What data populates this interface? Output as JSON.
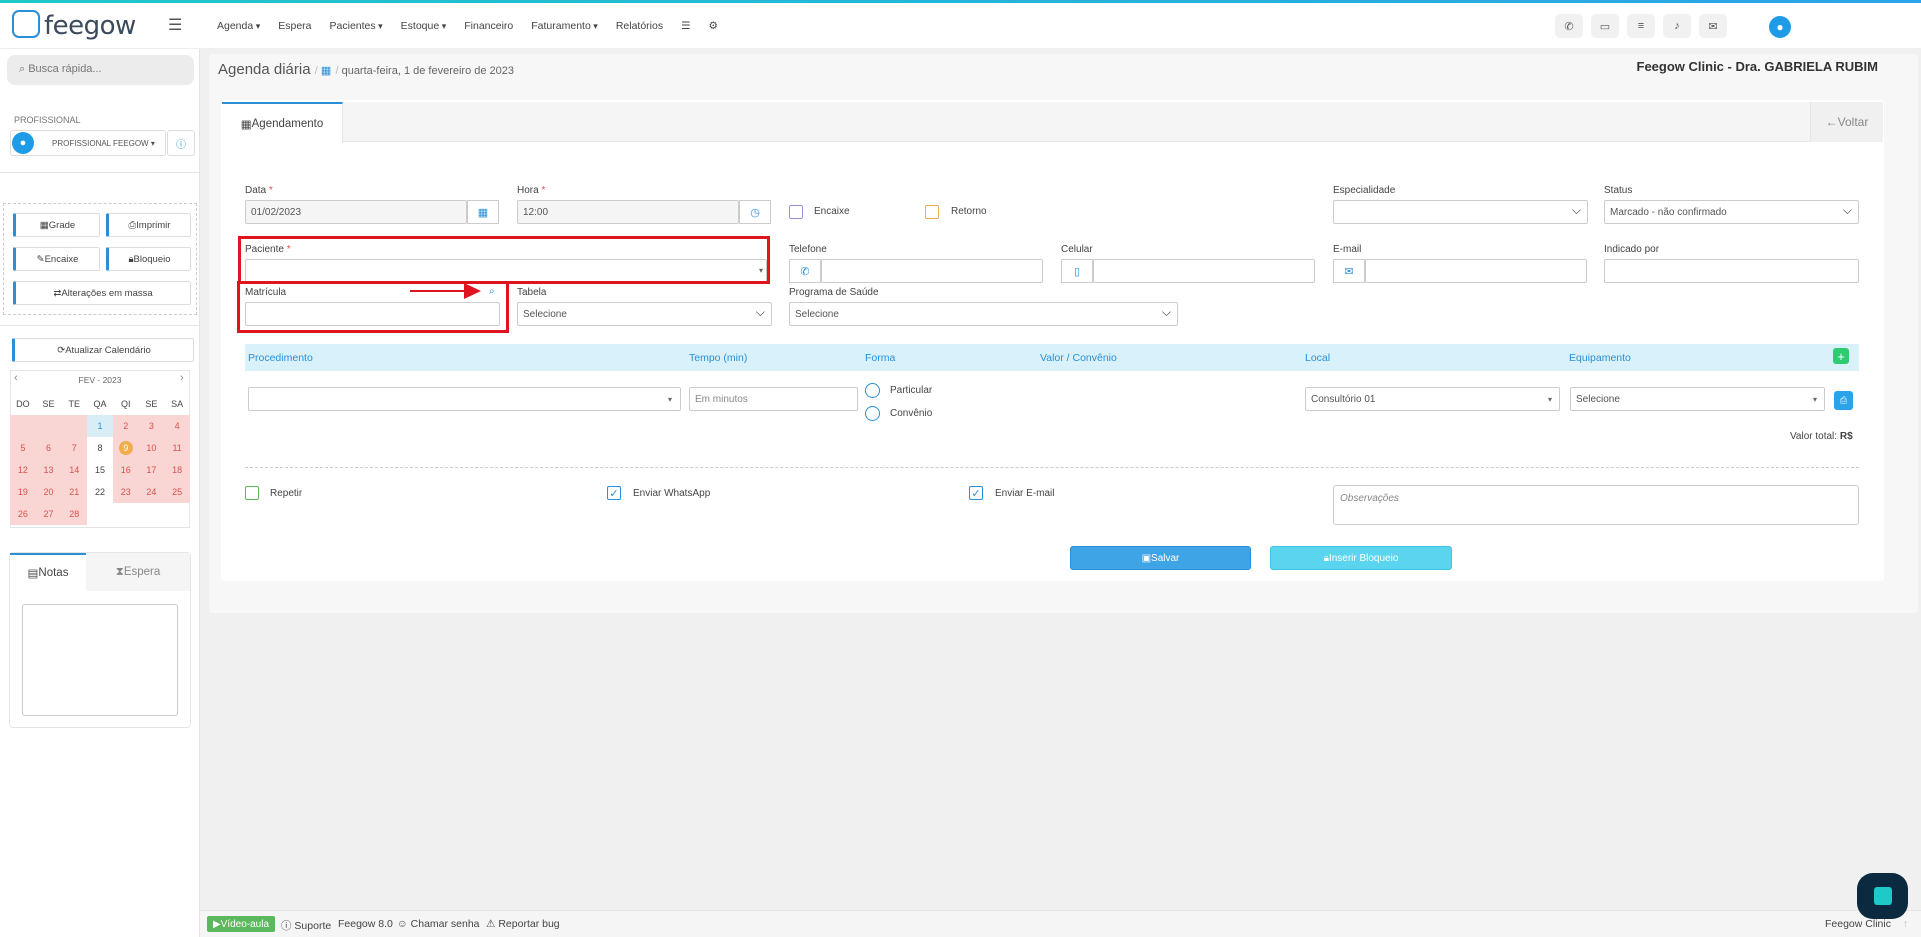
{
  "brand": {
    "name": "feegow"
  },
  "nav": {
    "items": [
      "Agenda",
      "Espera",
      "Pacientes",
      "Estoque",
      "Financeiro",
      "Faturamento",
      "Relatórios"
    ]
  },
  "sidebar": {
    "search_placeholder": "Busca rápida...",
    "profissional_label": "PROFISSIONAL",
    "profissional_value": "PROFISSIONAL FEEGOW",
    "buttons": {
      "grade": "Grade",
      "imprimir": "Imprimir",
      "encaixe": "Encaixe",
      "bloqueio": "Bloqueio",
      "alteracoes": "Alterações em massa",
      "atualizar": "Atualizar Calendário"
    },
    "calendar": {
      "month": "FEV - 2023",
      "dow": [
        "DO",
        "SE",
        "TE",
        "QA",
        "QI",
        "SE",
        "SA"
      ]
    },
    "tabs": {
      "notas": "Notas",
      "espera": "Espera"
    }
  },
  "header": {
    "title": "Agenda diária",
    "date": "quarta-feira, 1 de fevereiro de 2023",
    "clinic": "Feegow Clinic - Dra. GABRIELA RUBIM"
  },
  "form": {
    "tab": "Agendamento",
    "voltar": "Voltar",
    "data_label": "Data",
    "data_value": "01/02/2023",
    "hora_label": "Hora",
    "hora_value": "12:00",
    "encaixe": "Encaixe",
    "retorno": "Retorno",
    "especialidade_label": "Especialidade",
    "status_label": "Status",
    "status_value": "Marcado - não confirmado",
    "paciente_label": "Paciente",
    "telefone_label": "Telefone",
    "celular_label": "Celular",
    "email_label": "E-mail",
    "indicado_label": "Indicado por",
    "matricula_label": "Matrícula",
    "tabela_label": "Tabela",
    "tabela_value": "Selecione",
    "programa_label": "Programa de Saúde",
    "programa_value": "Selecione",
    "required_mark": "*",
    "proc_headers": {
      "procedimento": "Procedimento",
      "tempo": "Tempo (min)",
      "forma": "Forma",
      "valor": "Valor / Convênio",
      "local": "Local",
      "equipamento": "Equipamento"
    },
    "tempo_placeholder": "Em minutos",
    "particular": "Particular",
    "convenio": "Convênio",
    "local_value": "Consultório 01",
    "equip_value": "Selecione",
    "valor_total_label": "Valor total:",
    "valor_total_value": "R$",
    "repetir": "Repetir",
    "whatsapp": "Enviar WhatsApp",
    "email": "Enviar E-mail",
    "obs_placeholder": "Observações",
    "salvar": "Salvar",
    "inserir_bloqueio": "Inserir Bloqueio"
  },
  "footer": {
    "video": "Vídeo-aula",
    "suporte": "Suporte",
    "version": "Feegow 8.0",
    "chamar": "Chamar senha",
    "reportar": "Reportar bug",
    "brand": "Feegow Clinic"
  },
  "colors": {
    "accent": "#2a8fd6",
    "highlight": "#e0141e",
    "calendar_red": "#f9d5d3"
  }
}
